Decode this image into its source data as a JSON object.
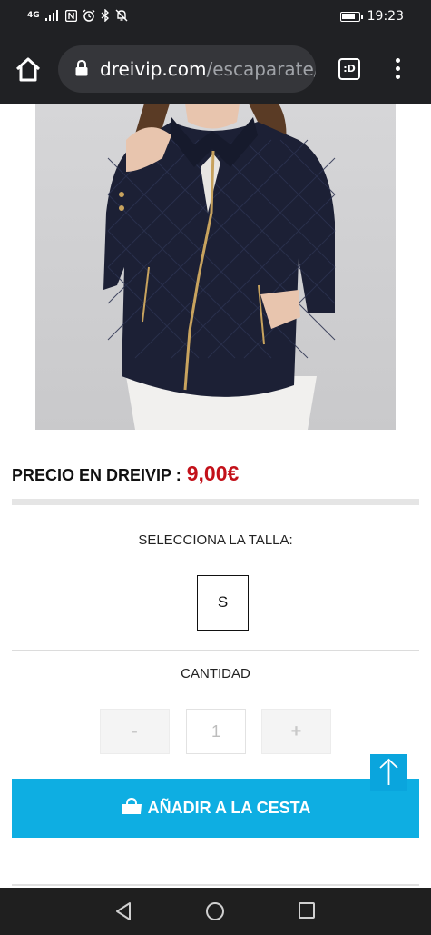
{
  "status_bar": {
    "network": "4G",
    "time": "19:23",
    "icons": [
      "signal-icon",
      "nfc-icon",
      "alarm-icon",
      "bluetooth-icon",
      "mute-icon",
      "battery-icon"
    ]
  },
  "browser": {
    "domain": "dreivip.com",
    "path": "/escaparate/",
    "tab_label": ":D"
  },
  "product": {
    "image_alt": "Chaqueta acolchada azul marino",
    "price_label": "PRECIO EN DREIVIP :",
    "price_value": "9,00€",
    "size_title": "SELECCIONA LA TALLA:",
    "sizes": [
      "S"
    ],
    "quantity_title": "CANTIDAD",
    "quantity": "1",
    "minus_label": "-",
    "plus_label": "+",
    "add_to_cart_label": "AÑADIR A LA CESTA"
  },
  "colors": {
    "accent": "#0eaee2",
    "price": "#c3111a",
    "jacket": "#1c2035"
  }
}
